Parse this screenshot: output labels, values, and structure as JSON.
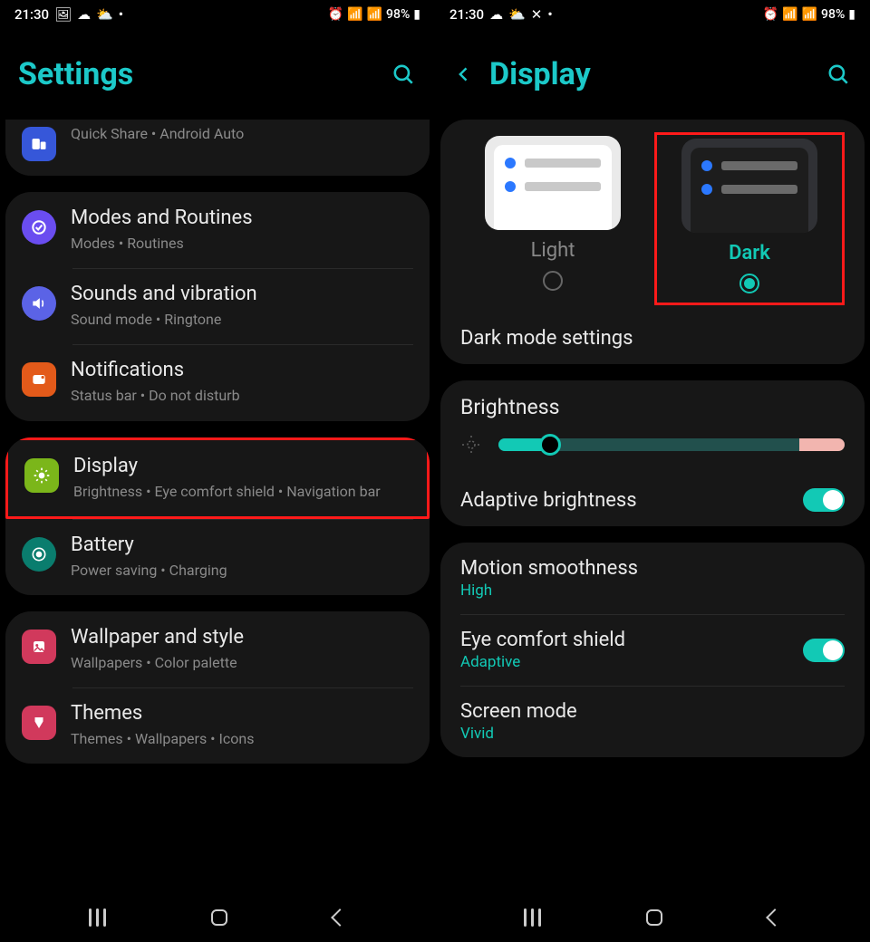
{
  "status": {
    "time": "21:30",
    "battery": "98%"
  },
  "left": {
    "title": "Settings",
    "connected_sub": "Quick Share  •  Android Auto",
    "items": [
      {
        "title": "Modes and Routines",
        "sub": "Modes  •  Routines"
      },
      {
        "title": "Sounds and vibration",
        "sub": "Sound mode  •  Ringtone"
      },
      {
        "title": "Notifications",
        "sub": "Status bar  •  Do not disturb"
      }
    ],
    "display": {
      "title": "Display",
      "sub": "Brightness  •  Eye comfort shield  •  Navigation bar"
    },
    "battery": {
      "title": "Battery",
      "sub": "Power saving  •  Charging"
    },
    "wallpaper": {
      "title": "Wallpaper and style",
      "sub": "Wallpapers  •  Color palette"
    },
    "themes": {
      "title": "Themes",
      "sub": "Themes  •  Wallpapers  •  Icons"
    }
  },
  "right": {
    "title": "Display",
    "theme": {
      "light": "Light",
      "dark": "Dark",
      "selected": "dark"
    },
    "dark_settings": "Dark mode settings",
    "brightness": {
      "label": "Brightness",
      "percent": 15
    },
    "adaptive": {
      "label": "Adaptive brightness",
      "on": true
    },
    "motion": {
      "label": "Motion smoothness",
      "value": "High"
    },
    "eye": {
      "label": "Eye comfort shield",
      "value": "Adaptive",
      "on": true
    },
    "screen": {
      "label": "Screen mode",
      "value": "Vivid"
    }
  },
  "colors": {
    "accent": "#12c9b5"
  }
}
